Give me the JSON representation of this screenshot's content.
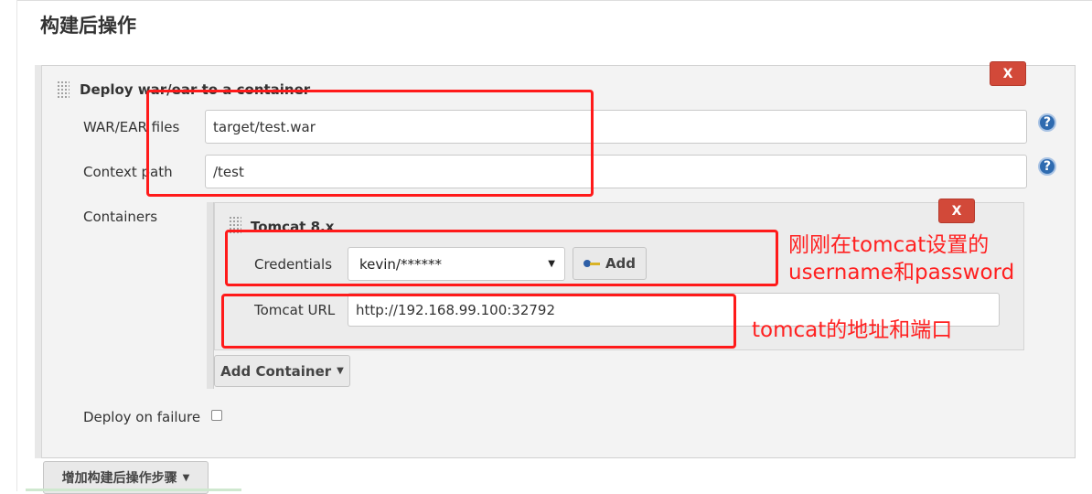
{
  "section": {
    "title": "构建后操作"
  },
  "deploy": {
    "header": "Deploy war/ear to a container",
    "delete_label": "X",
    "war_label": "WAR/EAR files",
    "war_value": "target/test.war",
    "context_label": "Context path",
    "context_value": "/test",
    "containers_label": "Containers",
    "help_glyph": "?",
    "on_failure_label": "Deploy on failure",
    "on_failure_checked": false
  },
  "container": {
    "header": "Tomcat 8.x",
    "delete_label": "X",
    "credentials_label": "Credentials",
    "credentials_value": "kevin/******",
    "add_label": "Add",
    "url_label": "Tomcat URL",
    "url_value": "http://192.168.99.100:32792",
    "add_container_label": "Add Container"
  },
  "footer": {
    "add_step_label": "增加构建后操作步骤"
  },
  "annotations": {
    "credentials_note_line1": "刚刚在tomcat设置的",
    "credentials_note_line2": "username和password",
    "url_note": "tomcat的地址和端口"
  },
  "colors": {
    "annotation": "#ff1a1a",
    "delete_button": "#d24939",
    "help_icon": "#2f6bb0"
  },
  "icons": [
    "drag-handle-icon",
    "help-icon",
    "key-icon",
    "dropdown-caret-icon",
    "close-icon"
  ]
}
